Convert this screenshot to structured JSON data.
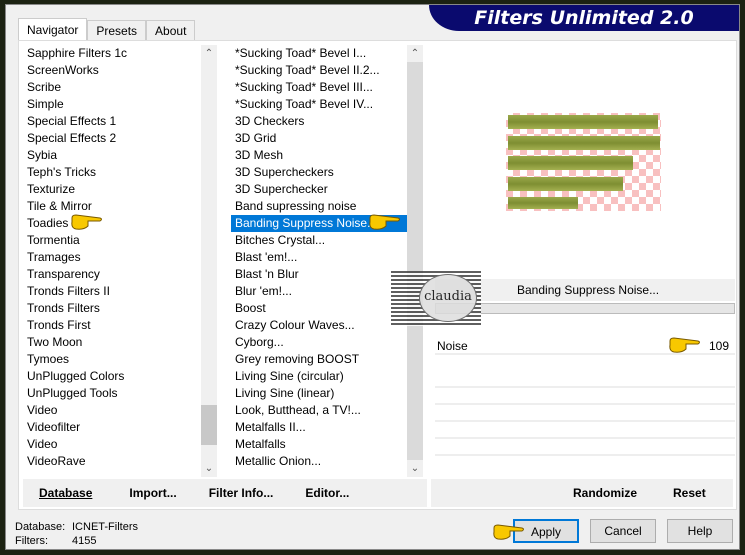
{
  "title": "Filters Unlimited 2.0",
  "tabs": [
    "Navigator",
    "Presets",
    "About"
  ],
  "categories": [
    "Sapphire Filters 1c",
    "ScreenWorks",
    "Scribe",
    "Simple",
    "Special Effects 1",
    "Special Effects 2",
    "Sybia",
    "Teph's Tricks",
    "Texturize",
    "Tile & Mirror",
    "Toadies",
    "Tormentia",
    "Tramages",
    "Transparency",
    "Tronds Filters II",
    "Tronds Filters",
    "Tronds First",
    "Two Moon",
    "Tymoes",
    "UnPlugged Colors",
    "UnPlugged Tools",
    "Video",
    "Videofilter",
    "Video",
    "VideoRave"
  ],
  "selected_category": "Toadies",
  "filters": [
    "*Sucking Toad*  Bevel I...",
    "*Sucking Toad*  Bevel II.2...",
    "*Sucking Toad*  Bevel III...",
    "*Sucking Toad*  Bevel IV...",
    "3D Checkers",
    "3D Grid",
    "3D Mesh",
    "3D Supercheckers",
    "3D Superchecker",
    "Band supressing noise",
    "Banding Suppress Noise...",
    "Bitches Crystal...",
    "Blast 'em!...",
    "Blast 'n Blur",
    "Blur 'em!...",
    "Boost",
    "Crazy Colour Waves...",
    "Cyborg...",
    "Grey removing BOOST",
    "Living Sine (circular)",
    "Living Sine (linear)",
    "Look, Butthead, a TV!...",
    "Metalfalls II...",
    "Metalfalls",
    "Metallic Onion..."
  ],
  "selected_filter": "Banding Suppress Noise...",
  "filter_name": "Banding Suppress Noise...",
  "param": {
    "label": "Noise",
    "value": "109"
  },
  "buttons": {
    "database": "Database",
    "import": "Import...",
    "filter_info": "Filter Info...",
    "editor": "Editor...",
    "randomize": "Randomize",
    "reset": "Reset",
    "apply": "Apply",
    "cancel": "Cancel",
    "help": "Help"
  },
  "status": {
    "database_label": "Database:",
    "database_value": "ICNET-Filters",
    "filters_label": "Filters:",
    "filters_value": "4155"
  },
  "watermark": "claudia",
  "colors": {
    "selection": "#0078d7",
    "banner": "#0a0a6e",
    "preview_bars": "#8a9a3e",
    "checker": "#f8c0c0"
  }
}
